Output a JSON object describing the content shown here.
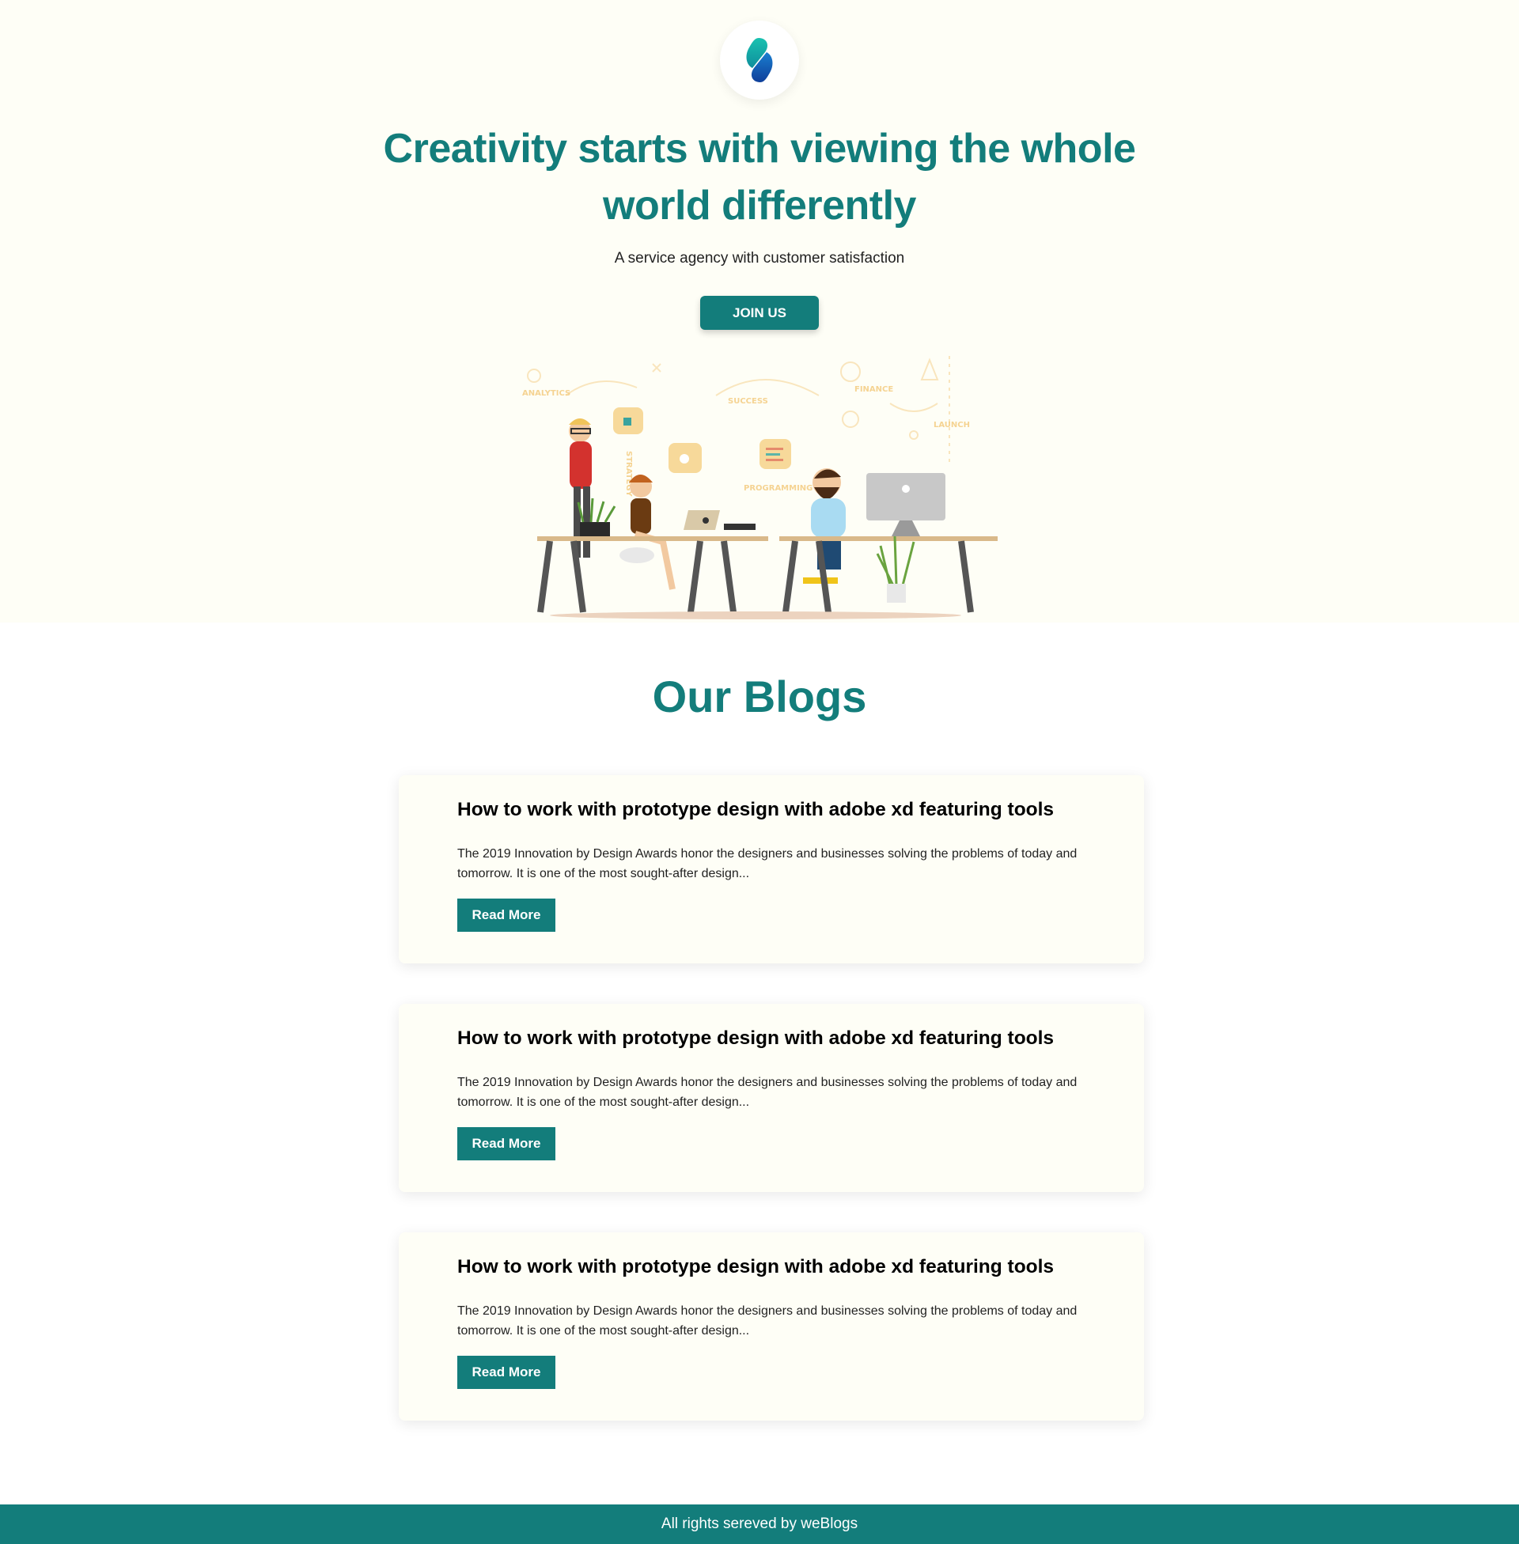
{
  "hero": {
    "logo_icon": "brand-s-logo-icon",
    "title": "Creativity starts with viewing the whole world differently",
    "subtitle": "A service agency with customer satisfaction",
    "cta_label": "JOIN US",
    "illustration_labels": [
      "ANALYTICS",
      "SUCCESS",
      "FINANCE",
      "LAUNCH",
      "PROGRAMMING",
      "STRATEGY"
    ]
  },
  "blogs": {
    "heading": "Our Blogs",
    "items": [
      {
        "title": "How to work with prototype design with adobe xd featuring tools",
        "excerpt": "The 2019 Innovation by Design Awards honor the designers and businesses solving the problems of today and tomorrow. It is one of the most sought-after design...",
        "button": "Read More"
      },
      {
        "title": "How to work with prototype design with adobe xd featuring tools",
        "excerpt": "The 2019 Innovation by Design Awards honor the designers and businesses solving the problems of today and tomorrow. It is one of the most sought-after design...",
        "button": "Read More"
      },
      {
        "title": "How to work with prototype design with adobe xd featuring tools",
        "excerpt": "The 2019 Innovation by Design Awards honor the designers and businesses solving the problems of today and tomorrow. It is one of the most sought-after design...",
        "button": "Read More"
      }
    ]
  },
  "footer": {
    "text": "All rights sereved by weBlogs"
  },
  "colors": {
    "accent": "#137d7b",
    "hero_bg": "#fefef6",
    "card_bg": "#fefef6",
    "footer_bg": "#137d7b"
  }
}
